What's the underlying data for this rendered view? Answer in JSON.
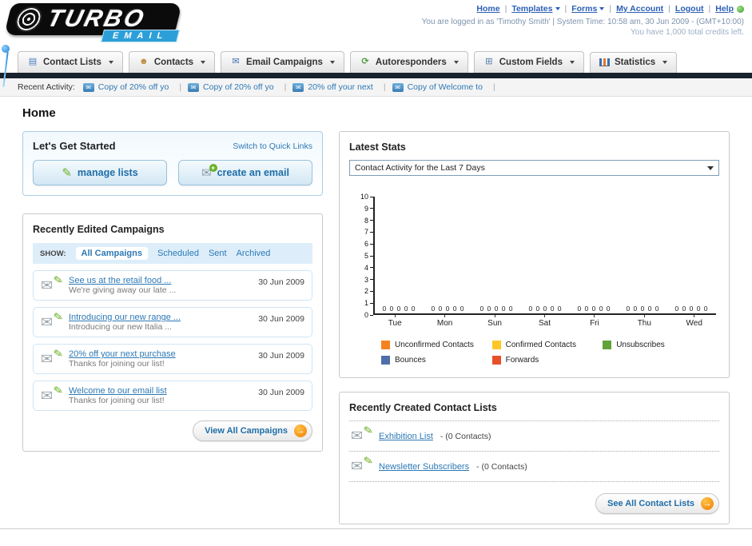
{
  "header": {
    "logo": {
      "title": "TURBO",
      "subtitle": "EMAIL"
    },
    "links": [
      {
        "label": "Home",
        "dropdown": false
      },
      {
        "label": "Templates",
        "dropdown": true
      },
      {
        "label": "Forms",
        "dropdown": true
      },
      {
        "label": "My Account",
        "dropdown": false
      },
      {
        "label": "Logout",
        "dropdown": false
      },
      {
        "label": "Help",
        "dropdown": false
      }
    ],
    "login_info": "You are logged in as 'Timothy Smith' | System Time: 10:58 am, 30 Jun 2009 - (GMT+10:00)",
    "credits": "You have 1,000 total credits left."
  },
  "nav": {
    "tabs": [
      {
        "label": "Contact Lists"
      },
      {
        "label": "Contacts"
      },
      {
        "label": "Email Campaigns"
      },
      {
        "label": "Autoresponders"
      },
      {
        "label": "Custom Fields"
      },
      {
        "label": "Statistics"
      }
    ]
  },
  "recent_activity": {
    "label": "Recent Activity:",
    "items": [
      {
        "text": "Copy of 20% off yo"
      },
      {
        "text": "Copy of 20% off yo"
      },
      {
        "text": "20% off your next"
      },
      {
        "text": "Copy of Welcome to"
      }
    ]
  },
  "page_title": "Home",
  "get_started": {
    "title": "Let's Get Started",
    "switch_link": "Switch to Quick Links",
    "buttons": [
      {
        "label": "manage lists"
      },
      {
        "label": "create an email"
      }
    ]
  },
  "campaigns": {
    "title": "Recently Edited Campaigns",
    "show_label": "SHOW:",
    "filters": [
      "All Campaigns",
      "Scheduled",
      "Sent",
      "Archived"
    ],
    "active_filter": "All Campaigns",
    "items": [
      {
        "title": "See us at the retail food ...",
        "subtitle": "We're giving away our late ...",
        "date": "30 Jun 2009"
      },
      {
        "title": "Introducing our new range ...",
        "subtitle": "Introducing our new Italia ...",
        "date": "30 Jun 2009"
      },
      {
        "title": "20% off your next purchase",
        "subtitle": "Thanks for joining our list!",
        "date": "30 Jun 2009"
      },
      {
        "title": "Welcome to our email list",
        "subtitle": "Thanks for joining our list!",
        "date": "30 Jun 2009"
      }
    ],
    "view_all_label": "View All Campaigns"
  },
  "stats": {
    "title": "Latest Stats",
    "dropdown_value": "Contact Activity for the Last 7 Days",
    "chart_data": {
      "type": "bar",
      "title": "Contact Activity for the Last 7 Days",
      "xlabel": "",
      "ylabel": "",
      "ylim": [
        0,
        10
      ],
      "grid": false,
      "legend_position": "bottom",
      "categories": [
        "Tue",
        "Mon",
        "Sun",
        "Sat",
        "Fri",
        "Thu",
        "Wed"
      ],
      "series": [
        {
          "name": "Unconfirmed Contacts",
          "color": "#f5821f",
          "values": [
            0,
            0,
            0,
            0,
            0,
            0,
            0
          ]
        },
        {
          "name": "Confirmed Contacts",
          "color": "#ffc726",
          "values": [
            0,
            0,
            0,
            0,
            0,
            0,
            0
          ]
        },
        {
          "name": "Unsubscribes",
          "color": "#62a339",
          "values": [
            0,
            0,
            0,
            0,
            0,
            0,
            0
          ]
        },
        {
          "name": "Bounces",
          "color": "#4f6fa8",
          "values": [
            0,
            0,
            0,
            0,
            0,
            0,
            0
          ]
        },
        {
          "name": "Forwards",
          "color": "#e8502a",
          "values": [
            0,
            0,
            0,
            0,
            0,
            0,
            0
          ]
        }
      ]
    }
  },
  "contact_lists": {
    "title": "Recently Created Contact Lists",
    "items": [
      {
        "name": "Exhibition List",
        "count": "- (0 Contacts)"
      },
      {
        "name": "Newsletter Subscribers",
        "count": "- (0 Contacts)"
      }
    ],
    "see_all_label": "See All Contact Lists"
  }
}
